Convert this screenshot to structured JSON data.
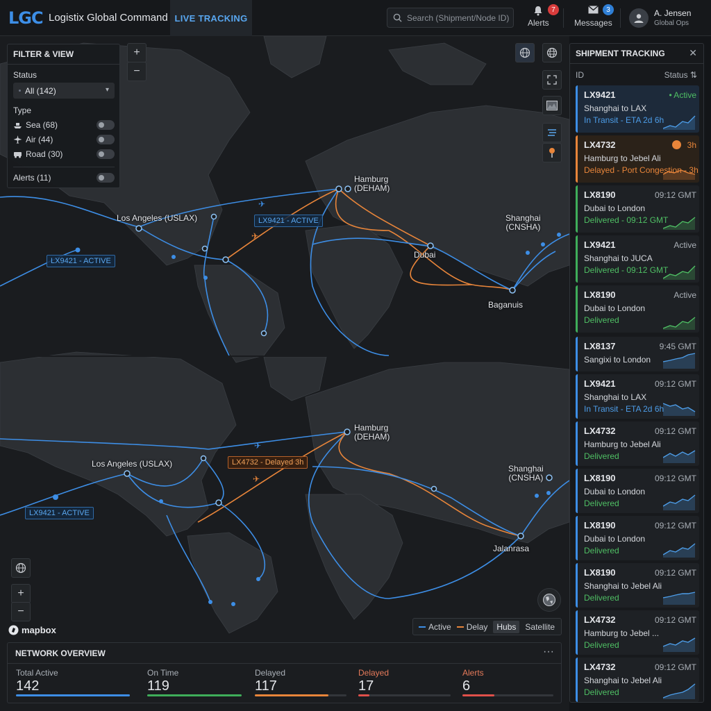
{
  "header": {
    "logo": "LGC",
    "app_title": "Logistix Global Command",
    "tab_live": "LIVE TRACKING",
    "search_placeholder": "Search (Shipment/Node ID)",
    "alerts_label": "Alerts",
    "alerts_count": "7",
    "messages_label": "Messages",
    "messages_count": "3",
    "user_name": "A. Jensen",
    "user_role": "Global Ops"
  },
  "filter": {
    "title": "FILTER & VIEW",
    "status_label": "Status",
    "status_value": "All (142)",
    "type_label": "Type",
    "types": [
      {
        "label": "Sea (68)",
        "icon": "ship-icon"
      },
      {
        "label": "Air (44)",
        "icon": "plane-icon"
      },
      {
        "label": "Road (30)",
        "icon": "truck-icon"
      }
    ],
    "alerts_label": "Alerts (11)"
  },
  "map": {
    "cities": {
      "hamburg_top": "Hamburg\n(DEHAM)",
      "la_top": "Los Angeles (USLAX)",
      "shanghai_top": "Shanghai\n(CNSHA)",
      "dubai_top": "Dubai",
      "singapore_top": "Baganuis",
      "hamburg_bot": "Hamburg\n(DEHAM)",
      "la_bot": "Los Angeles (USLAX)",
      "shanghai_bot": "Shanghai\n(CNSHA)",
      "singapore_bot": "Jalanrasa"
    },
    "tags": {
      "tag1": "LX9421 - ACTIVE",
      "tag2": "LX9421 - ACTIVE",
      "tag3": "LX4732 - Delayed 3h",
      "tag4": "LX9421 - ACTIVE"
    },
    "attribution": "mapbox"
  },
  "legend": {
    "active": "Active",
    "delay": "Delay",
    "hubs": "Hubs",
    "satellite": "Satellite",
    "colors": {
      "active": "#3d8ee6",
      "delay": "#e8853a"
    }
  },
  "overview": {
    "title": "NETWORK OVERVIEW",
    "kpis": [
      {
        "label": "Total Active",
        "value": "142",
        "color": "#3d8ee6",
        "fill": 1.0
      },
      {
        "label": "On Time",
        "value": "119",
        "color": "#3fae5a",
        "fill": 1.0
      },
      {
        "label": "Delayed",
        "value": "117",
        "color": "#e8853a",
        "fill": 0.8
      },
      {
        "label": "Delayed",
        "value": "17",
        "color": "#e0504a",
        "fill": 0.12
      },
      {
        "label": "Alerts",
        "value": "6",
        "color": "#e0504a",
        "fill": 0.35
      }
    ]
  },
  "shipments": {
    "title": "SHIPMENT TRACKING",
    "col_id": "ID",
    "col_status": "Status",
    "items": [
      {
        "id": "LX9421",
        "right": "• Active",
        "route": "Shanghai to LAX",
        "status": "In Transit - ETA 2d 6h",
        "kind": "sel",
        "status_color": "#4d9de8"
      },
      {
        "id": "LX4732",
        "right": "3h",
        "route": "Hamburg to Jebel Ali",
        "status": "Delayed - Port Congestion - 3h",
        "kind": "delay",
        "status_color": "#e8853a"
      },
      {
        "id": "LX8190",
        "right": "09:12 GMT",
        "route": "Dubai to London",
        "status": "Delivered - 09:12 GMT",
        "kind": "green",
        "status_color": "#4fbf64"
      },
      {
        "id": "LX9421",
        "right": "Active",
        "route": "Shanghai to JUCA",
        "status": "Delivered - 09:12 GMT",
        "kind": "green",
        "status_color": "#4fbf64"
      },
      {
        "id": "LX8190",
        "right": "Active",
        "route": "Dubai to London",
        "status": "Delivered",
        "kind": "green",
        "status_color": "#4fbf64"
      },
      {
        "id": "LX8137",
        "right": "9:45 GMT",
        "route": "Sangixi to London",
        "status": "",
        "kind": "blue",
        "status_color": "#4fbf64"
      },
      {
        "id": "LX9421",
        "right": "09:12 GMT",
        "route": "Shanghai to LAX",
        "status": "In Transit - ETA 2d 6h",
        "kind": "blue",
        "status_color": "#4d9de8"
      },
      {
        "id": "LX4732",
        "right": "09:12 GMT",
        "route": "Hamburg to Jebel Ali",
        "status": "Delivered",
        "kind": "blue",
        "status_color": "#4fbf64"
      },
      {
        "id": "LX8190",
        "right": "09:12 GMT",
        "route": "Dubai to London",
        "status": "Delivered",
        "kind": "blue",
        "status_color": "#4fbf64"
      },
      {
        "id": "LX8190",
        "right": "09:12 GMT",
        "route": "Dubai to London",
        "status": "Delivered",
        "kind": "blue",
        "status_color": "#4fbf64"
      },
      {
        "id": "LX8190",
        "right": "09:12 GMT",
        "route": "Shanghai to Jebel Ali",
        "status": "Delivered",
        "kind": "blue",
        "status_color": "#4fbf64"
      },
      {
        "id": "LX4732",
        "right": "09:12 GMT",
        "route": "Hamburg to Jebel ...",
        "status": "Delivered",
        "kind": "blue",
        "status_color": "#4fbf64"
      },
      {
        "id": "LX4732",
        "right": "09:12 GMT",
        "route": "Shanghai to Jebel Ali",
        "status": "Delivered",
        "kind": "blue",
        "status_color": "#4fbf64"
      }
    ]
  }
}
